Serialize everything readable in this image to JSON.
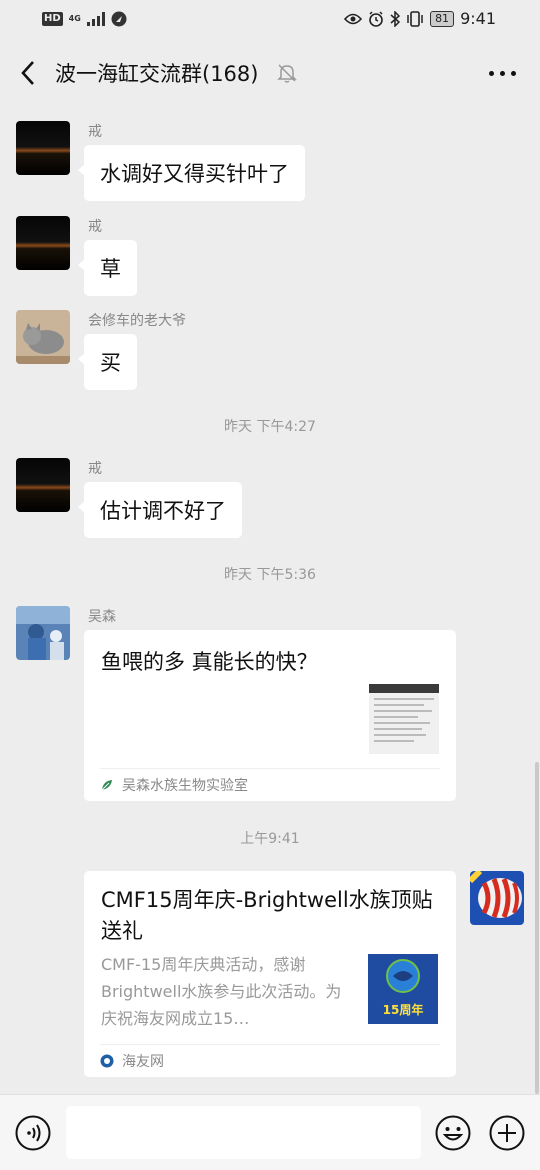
{
  "status": {
    "left": [
      "HD",
      "4G"
    ],
    "battery": "81",
    "time": "9:41"
  },
  "header": {
    "title": "波一海缸交流群(168)",
    "back_icon": "chevron-left-icon",
    "muted_icon": "bell-off-icon",
    "more_icon": "more-dots-icon"
  },
  "messages": [
    {
      "sender": "戒",
      "text": "水调好又得买针叶了"
    },
    {
      "sender": "戒",
      "text": "草"
    },
    {
      "sender": "会修车的老大爷",
      "text": "买"
    },
    {
      "time": "昨天 下午4:27"
    },
    {
      "sender": "戒",
      "text": "估计调不好了"
    },
    {
      "time": "昨天 下午5:36"
    },
    {
      "sender": "吴森",
      "card_title": "鱼喂的多 真能长的快？",
      "source": "吴森水族生物实验室"
    },
    {
      "time": "上午9:41"
    },
    {
      "card_title": "CMF15周年庆-Brightwell水族顶贴送礼",
      "card_desc": "CMF-15周年庆典活动，感谢Brightwell水族参与此次活动。为庆祝海友网成立15…",
      "source": "海友网",
      "thumb_text": "15周年"
    }
  ],
  "input": {
    "voice_icon": "voice-icon",
    "emoji_icon": "emoji-icon",
    "plus_icon": "plus-icon"
  },
  "colors": {
    "background": "#ededed",
    "bubble": "#ffffff",
    "meta_text": "#999999"
  }
}
